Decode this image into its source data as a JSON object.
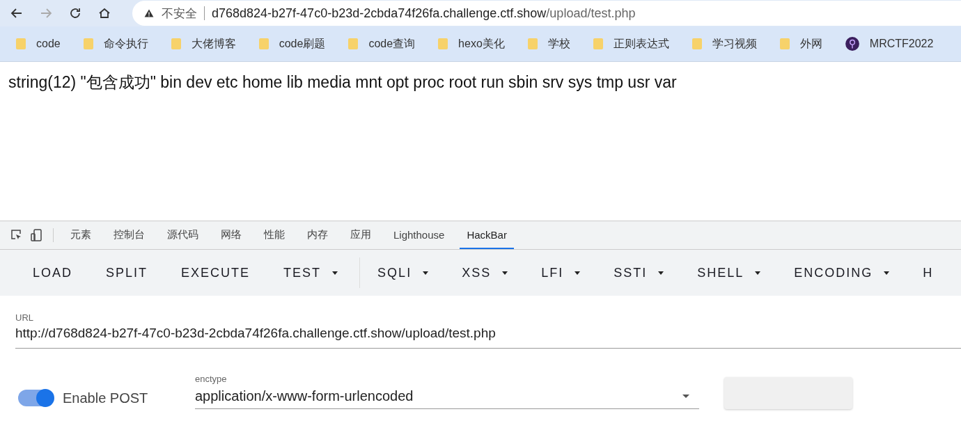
{
  "browser": {
    "security_label": "不安全",
    "url_host": "d768d824-b27f-47c0-b23d-2cbda74f26fa.challenge.ctf.show",
    "url_path": "/upload/test.php"
  },
  "bookmarks": [
    {
      "label": "code",
      "kind": "folder"
    },
    {
      "label": "命令执行",
      "kind": "folder"
    },
    {
      "label": "大佬博客",
      "kind": "folder"
    },
    {
      "label": "code刷题",
      "kind": "folder"
    },
    {
      "label": "code查询",
      "kind": "folder"
    },
    {
      "label": "hexo美化",
      "kind": "folder"
    },
    {
      "label": "学校",
      "kind": "folder"
    },
    {
      "label": "正则表达式",
      "kind": "folder"
    },
    {
      "label": "学习视频",
      "kind": "folder"
    },
    {
      "label": "外网",
      "kind": "folder"
    },
    {
      "label": "MRCTF2022",
      "kind": "site"
    }
  ],
  "page_output": "string(12) \"包含成功\" bin dev etc home lib media mnt opt proc root run sbin srv sys tmp usr var",
  "devtools_tabs": [
    {
      "label": "元素",
      "selected": false
    },
    {
      "label": "控制台",
      "selected": false
    },
    {
      "label": "源代码",
      "selected": false
    },
    {
      "label": "网络",
      "selected": false
    },
    {
      "label": "性能",
      "selected": false
    },
    {
      "label": "内存",
      "selected": false
    },
    {
      "label": "应用",
      "selected": false
    },
    {
      "label": "Lighthouse",
      "selected": false
    },
    {
      "label": "HackBar",
      "selected": true
    }
  ],
  "hackbar_toolbar": [
    {
      "label": "LOAD",
      "dropdown": false
    },
    {
      "label": "SPLIT",
      "dropdown": false
    },
    {
      "label": "EXECUTE",
      "dropdown": false
    },
    {
      "label": "TEST",
      "dropdown": true
    },
    {
      "label": "SQLI",
      "dropdown": true
    },
    {
      "label": "XSS",
      "dropdown": true
    },
    {
      "label": "LFI",
      "dropdown": true
    },
    {
      "label": "SSTI",
      "dropdown": true
    },
    {
      "label": "SHELL",
      "dropdown": true
    },
    {
      "label": "ENCODING",
      "dropdown": true
    },
    {
      "label": "H",
      "dropdown": false
    }
  ],
  "url_field": {
    "label": "URL",
    "value": "http://d768d824-b27f-47c0-b23d-2cbda74f26fa.challenge.ctf.show/upload/test.php"
  },
  "enable_post": {
    "label": "Enable POST",
    "on": true
  },
  "enctype": {
    "label": "enctype",
    "value": "application/x-www-form-urlencoded"
  }
}
